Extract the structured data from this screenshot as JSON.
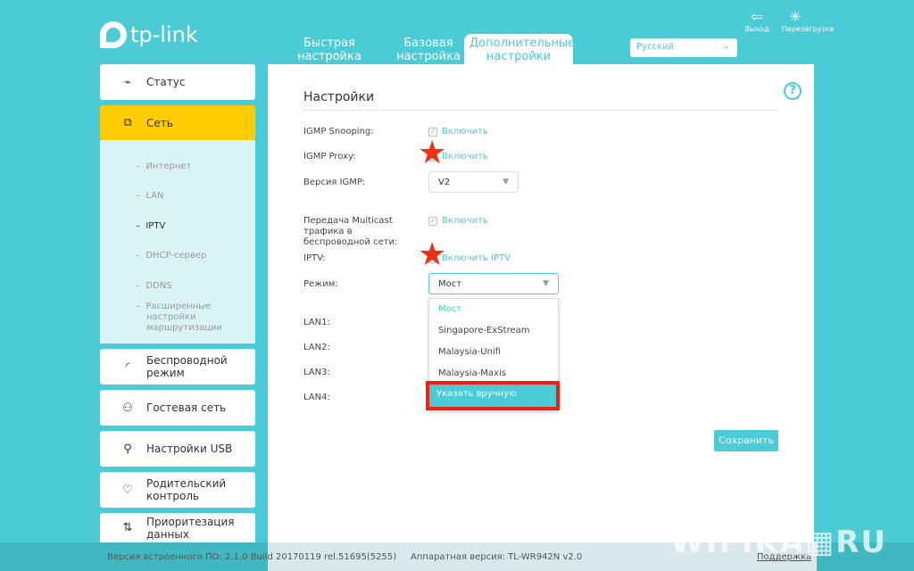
{
  "brand": "tp-link",
  "tabs": [
    {
      "label": "Быстрая настройка"
    },
    {
      "label": "Базовая настройка"
    },
    {
      "label": "Дополнительные настройки"
    }
  ],
  "language": "Русский",
  "top_actions": {
    "logout": "Выход",
    "reboot": "Перезагрузка"
  },
  "sidebar": {
    "items": [
      {
        "label": "Статус",
        "icon": "pulse-icon"
      },
      {
        "label": "Сеть",
        "icon": "network-icon"
      },
      {
        "label": "Беспроводной режим",
        "icon": "wifi-icon"
      },
      {
        "label": "Гостевая сеть",
        "icon": "guests-icon"
      },
      {
        "label": "Настройки USB",
        "icon": "usb-icon"
      },
      {
        "label": "Родительский контроль",
        "icon": "heart-icon"
      },
      {
        "label": "Приоритезация данных",
        "icon": "sort-icon"
      }
    ],
    "sub": [
      "Интернет",
      "LAN",
      "IPTV",
      "DHCP-сервер",
      "DDNS",
      "Расширенные настройки маршрутизации"
    ]
  },
  "main": {
    "title": "Настройки",
    "help": "?",
    "igmp_snooping": {
      "label": "IGMP Snooping:",
      "check": "Включить",
      "checked": true
    },
    "igmp_proxy": {
      "label": "IGMP Proxy:",
      "check": "Включить"
    },
    "igmp_version": {
      "label": "Версия IGMP:",
      "value": "V2"
    },
    "multicast": {
      "label": "Передача Multicast трафика в беспроводной сети:",
      "check": "Включить",
      "checked": true
    },
    "iptv": {
      "label": "IPTV:",
      "check": "Включить IPTV"
    },
    "mode": {
      "label": "Режим:",
      "value": "Мост",
      "options": [
        "Мост",
        "Singapore-ExStream",
        "Malaysia-Unifi",
        "Malaysia-Maxis",
        "Указать вручную"
      ]
    },
    "lans": [
      "LAN1:",
      "LAN2:",
      "LAN3:",
      "LAN4:"
    ],
    "save": "Сохранить"
  },
  "footer": {
    "firmware": "Версия встроенного ПО: 2.1.0 Build 20170119 rel.51695(5255)",
    "hardware": "Аппаратная версия: TL-WR942N v2.0",
    "support": "Поддержка"
  },
  "watermark": "WIFIKA.RU"
}
